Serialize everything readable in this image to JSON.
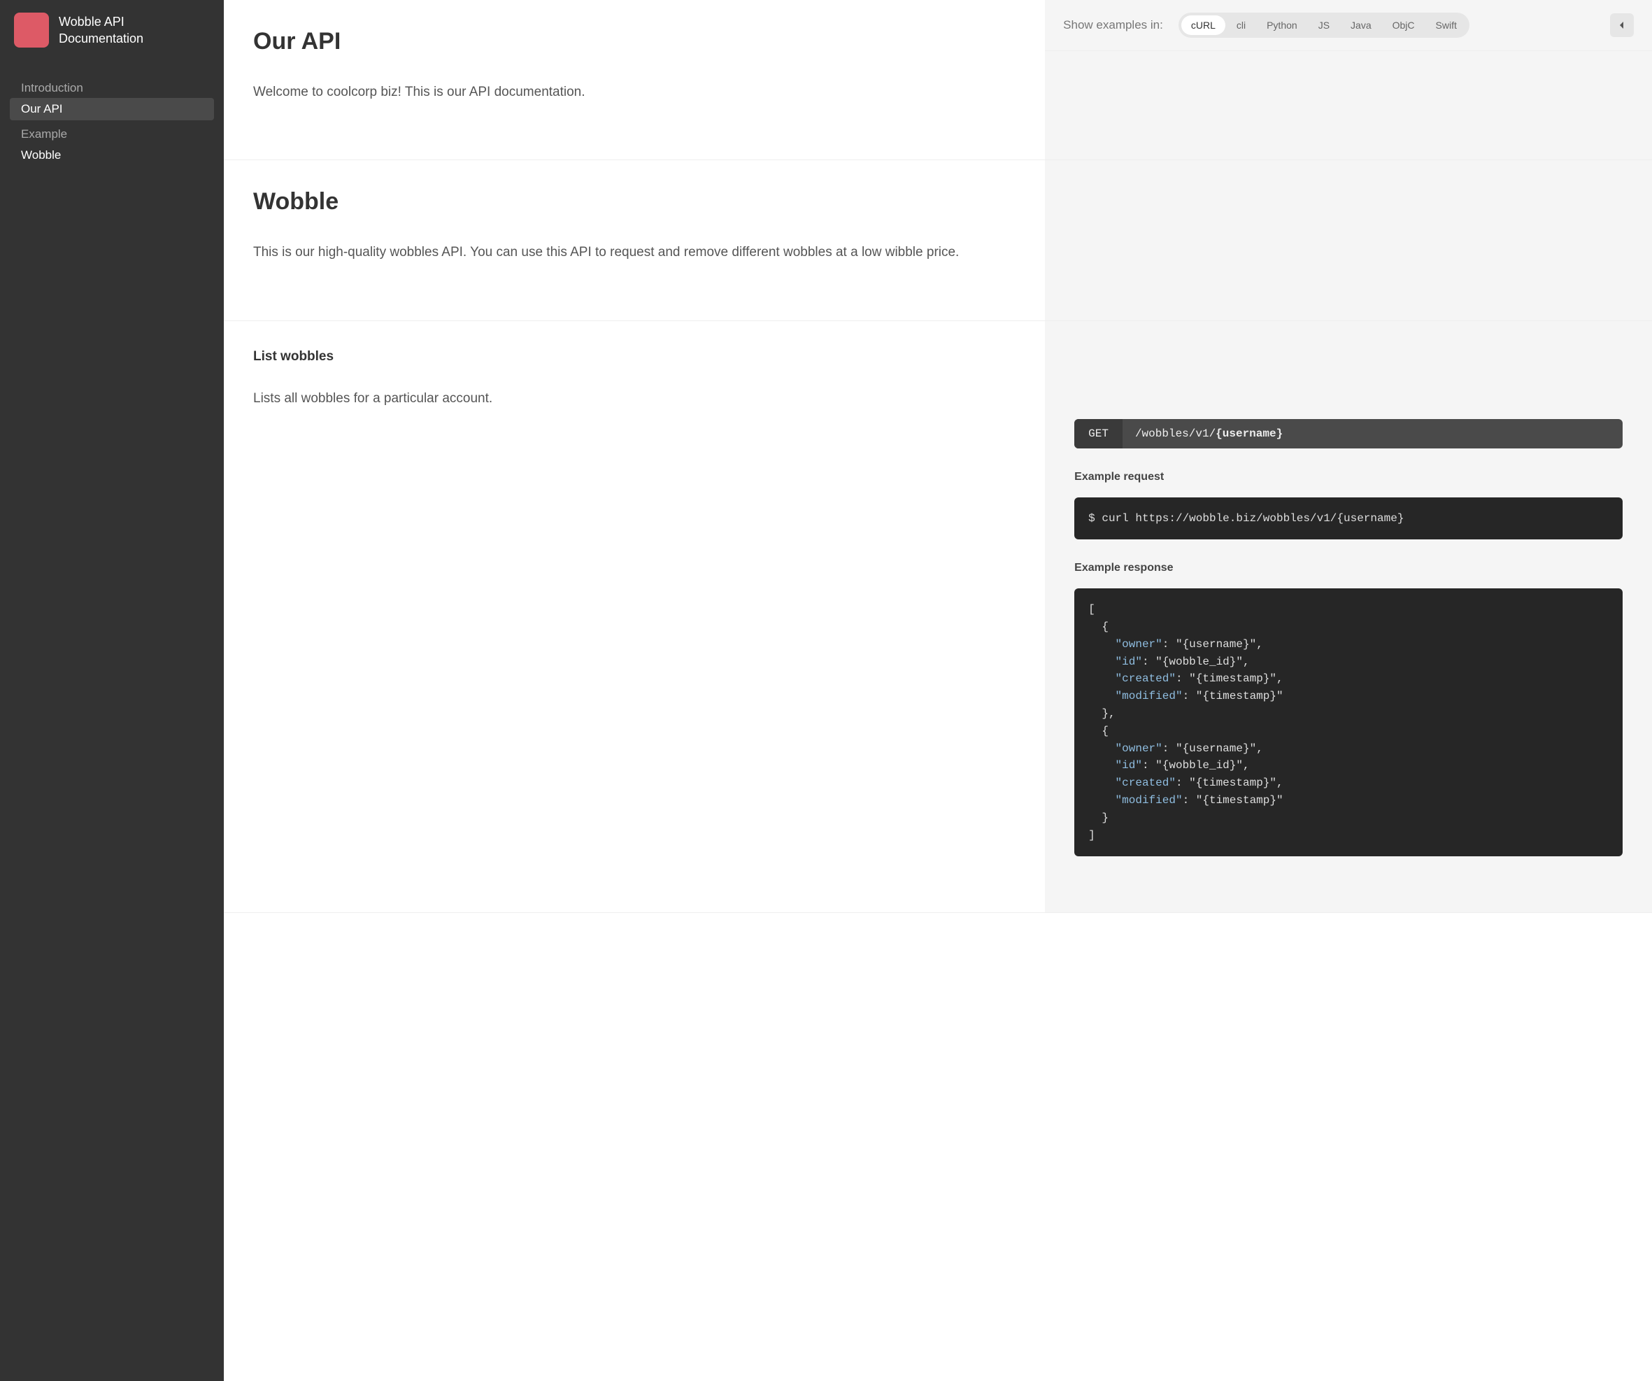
{
  "sidebar": {
    "title": "Wobble API Documentation",
    "sections": [
      {
        "label": "Introduction",
        "items": [
          {
            "label": "Our API",
            "active": true
          }
        ]
      },
      {
        "label": "Example",
        "items": [
          {
            "label": "Wobble",
            "active": false
          }
        ]
      }
    ]
  },
  "lang_bar": {
    "label": "Show examples in:",
    "langs": [
      "cURL",
      "cli",
      "Python",
      "JS",
      "Java",
      "ObjC",
      "Swift"
    ],
    "active": "cURL"
  },
  "sections": {
    "our_api": {
      "heading": "Our API",
      "body": "Welcome to coolcorp biz! This is our API documentation."
    },
    "wobble": {
      "heading": "Wobble",
      "body": "This is our high-quality wobbles API. You can use this API to request and remove different wobbles at a low wibble price."
    },
    "list_wobbles": {
      "heading": "List wobbles",
      "body": "Lists all wobbles for a particular account.",
      "endpoint": {
        "method": "GET",
        "path_prefix": "/wobbles/v1/",
        "path_param": "{username}"
      },
      "example_request_heading": "Example request",
      "example_request": "$ curl https://wobble.biz/wobbles/v1/{username}",
      "example_response_heading": "Example response",
      "example_response": [
        {
          "owner": "{username}",
          "id": "{wobble_id}",
          "created": "{timestamp}",
          "modified": "{timestamp}"
        },
        {
          "owner": "{username}",
          "id": "{wobble_id}",
          "created": "{timestamp}",
          "modified": "{timestamp}"
        }
      ]
    }
  }
}
